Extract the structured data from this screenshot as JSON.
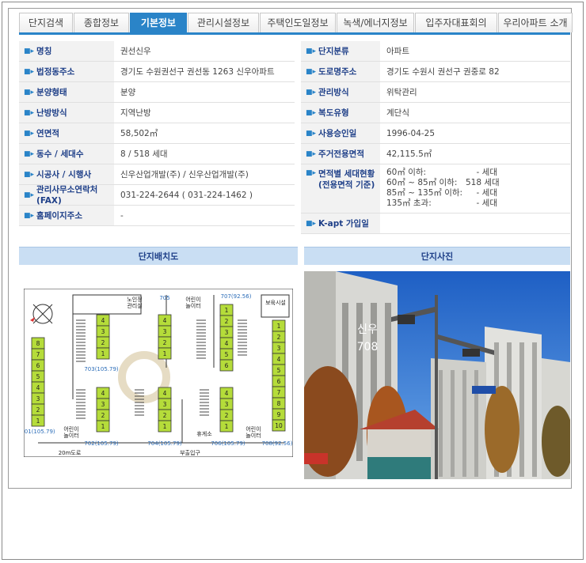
{
  "tabs": [
    {
      "label": "단지검색",
      "active": false
    },
    {
      "label": "종합정보",
      "active": false
    },
    {
      "label": "기본정보",
      "active": true
    },
    {
      "label": "관리시설정보",
      "active": false
    },
    {
      "label": "주택인도일정보",
      "active": false
    },
    {
      "label": "녹색/에너지정보",
      "active": false
    },
    {
      "label": "입주자대표회의",
      "active": false
    },
    {
      "label": "우리아파트 소개",
      "active": false
    }
  ],
  "left_info": [
    {
      "label": "명칭",
      "value": "권선신우"
    },
    {
      "label": "법정동주소",
      "value": "경기도 수원권선구 권선동 1263 신우아파트"
    },
    {
      "label": "분양형태",
      "value": "분양"
    },
    {
      "label": "난방방식",
      "value": "지역난방"
    },
    {
      "label": "연면적",
      "value": "58,502㎡"
    },
    {
      "label": "동수 / 세대수",
      "value": "8 / 518 세대"
    },
    {
      "label": "시공사 / 시행사",
      "value": "신우산업개발(주) / 신우산업개발(주)"
    },
    {
      "label": "관리사무소연락처(FAX)",
      "value": "031-224-2644 ( 031-224-1462 )"
    },
    {
      "label": "홈페이지주소",
      "value": "-"
    }
  ],
  "right_info": [
    {
      "label": "단지분류",
      "value": "아파트"
    },
    {
      "label": "도로명주소",
      "value": "경기도 수원시 권선구 권중로 82"
    },
    {
      "label": "관리방식",
      "value": "위탁관리"
    },
    {
      "label": "복도유형",
      "value": "계단식"
    },
    {
      "label": "사용승인일",
      "value": "1996-04-25"
    },
    {
      "label": "주거전용면적",
      "value": "42,115.5㎡"
    }
  ],
  "area_dist": {
    "label": "면적별 세대현황\n(전용면적 기준)",
    "rows": [
      {
        "range": "60㎡ 이하:",
        "count": "- 세대"
      },
      {
        "range": "60㎡ ~ 85㎡ 이하:",
        "count": "518 세대"
      },
      {
        "range": "85㎡ ~ 135㎡ 이하:",
        "count": "- 세대"
      },
      {
        "range": "135㎡ 초과:",
        "count": "- 세대"
      }
    ]
  },
  "kapt": {
    "label": "K-apt 가입일",
    "value": ""
  },
  "sections": {
    "plan_title": "단지배치도",
    "photo_title": "단지사진"
  },
  "plan": {
    "facilities": {
      "senior": "노인정\n관리실",
      "playground_top": "어린이\n놀이터",
      "security": "보육시설",
      "playground_left": "어린이\n놀이터",
      "rest": "휴게소",
      "playground_right": "어린이\n놀이터",
      "road": "20m도로",
      "entrance": "부출입구"
    },
    "buildings": [
      {
        "name": "701",
        "area": "(105.79)",
        "floors": [
          "8",
          "7",
          "6",
          "5",
          "4",
          "3",
          "2",
          "1"
        ]
      },
      {
        "name": "702",
        "area": "(105.79)",
        "floors": [
          "4",
          "3",
          "2",
          "1"
        ]
      },
      {
        "name": "703",
        "area": "(105.79)",
        "floors": [
          "4",
          "3",
          "2",
          "1"
        ]
      },
      {
        "name": "704",
        "area": "(105.79)",
        "floors": [
          "4",
          "3",
          "2",
          "1"
        ]
      },
      {
        "name": "705",
        "area": "",
        "floors": [
          "4",
          "3",
          "2",
          "1"
        ]
      },
      {
        "name": "706",
        "area": "(105.79)",
        "floors": [
          "4",
          "3",
          "2",
          "1"
        ]
      },
      {
        "name": "707",
        "area": "(92.56)",
        "floors": [
          "1",
          "2",
          "3",
          "4",
          "5",
          "6"
        ]
      },
      {
        "name": "708",
        "area": "(92.56)",
        "floors": [
          "1",
          "2",
          "3",
          "4",
          "5",
          "6",
          "7",
          "8",
          "9",
          "10"
        ]
      }
    ]
  },
  "photo": {
    "sign_line1": "신우",
    "sign_line2": "708"
  }
}
